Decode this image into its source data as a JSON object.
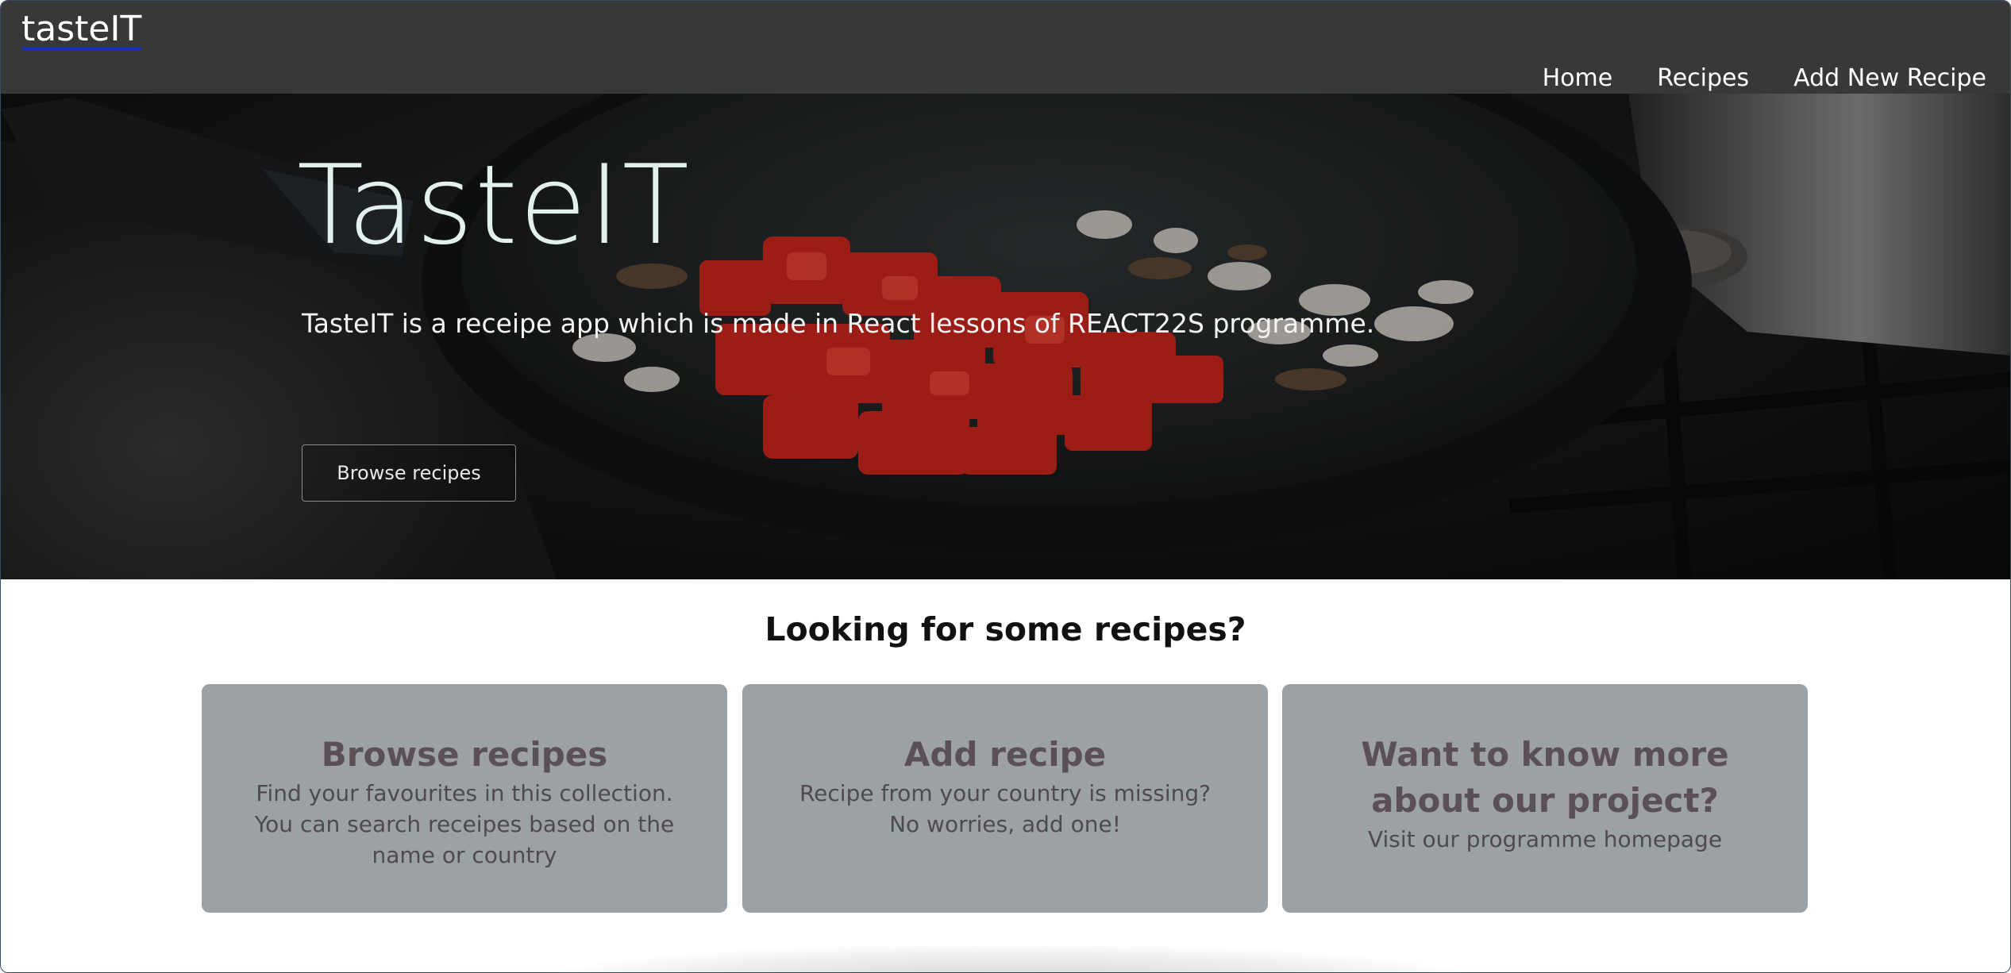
{
  "header": {
    "brand": "tasteIT",
    "nav": [
      "Home",
      "Recipes",
      "Add New Recipe"
    ]
  },
  "hero": {
    "title": "TasteIT",
    "subtitle": "TasteIT is a receipe app which is made in React lessons of REACT22S programme.",
    "button": "Browse recipes"
  },
  "section": {
    "title": "Looking for some recipes?",
    "cards": [
      {
        "title": "Browse recipes",
        "text": "Find your favourites in this collection. You can search receipes based on the name or country"
      },
      {
        "title": "Add recipe",
        "text": "Recipe from your country is missing? No worries, add one!"
      },
      {
        "title": "Want to know more about our project?",
        "text": "Visit our programme homepage"
      }
    ]
  },
  "colors": {
    "header_bg": "#383838",
    "card_bg": "#9ca1a6",
    "hero_title": "#e3f1ee",
    "brand_underline": "#1a2fb0"
  }
}
